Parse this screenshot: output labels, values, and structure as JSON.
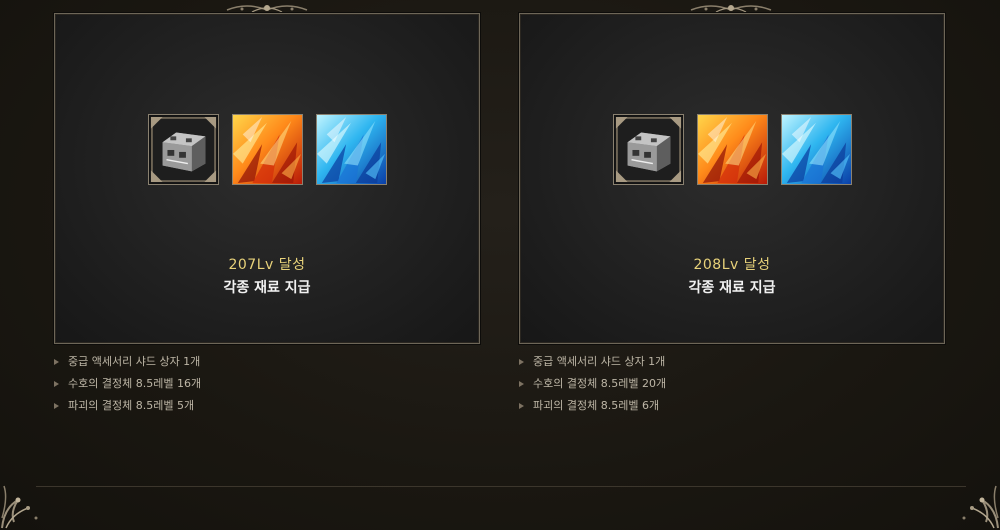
{
  "cards": [
    {
      "level_text": "207Lv  달성",
      "reward_text": "각종 재료 지급",
      "icons": [
        "accessory-shard-box-icon",
        "fire-crystal-icon",
        "ice-crystal-icon"
      ],
      "items": [
        "중급 액세서리 샤드 상자 1개",
        "수호의 결정체 8.5레벨 16개",
        "파괴의 결정체 8.5레벨 5개"
      ]
    },
    {
      "level_text": "208Lv  달성",
      "reward_text": "각종 재료 지급",
      "icons": [
        "accessory-shard-box-icon",
        "fire-crystal-icon",
        "ice-crystal-icon"
      ],
      "items": [
        "중급 액세서리 샤드 상자 1개",
        "수호의 결정체 8.5레벨 20개",
        "파괴의 결정체 8.5레벨 6개"
      ]
    }
  ],
  "colors": {
    "level_text": "#e8d27a",
    "reward_text": "#f2f2f2",
    "list_text": "#bdb6a6",
    "panel_border": "#6d6658",
    "background": "#1c1913"
  }
}
